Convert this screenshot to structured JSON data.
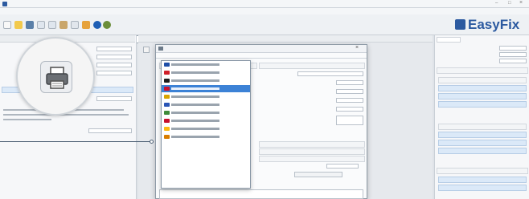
{
  "window": {
    "title": "",
    "minimize": "–",
    "maximize": "□",
    "close": "×"
  },
  "menu": [
    "",
    "",
    ""
  ],
  "toolbar": {
    "language_label": "",
    "brand": "EasyFix",
    "colors": {
      "brand_blue": "#2c5aa0",
      "selection": "#3c82d6",
      "header_blue": "#3a78c6"
    }
  },
  "left_panel": {
    "tabs": [
      "",
      "",
      ""
    ],
    "note": "",
    "value": ""
  },
  "center": {
    "tabs": [
      "",
      ""
    ]
  },
  "print_dialog": {
    "title": "",
    "tabs": [
      "",
      ""
    ],
    "close": "×",
    "language_section_header": "",
    "row_labels": [
      "",
      "",
      "",
      ""
    ],
    "languages": [
      {
        "code": "",
        "flag": "#1f4fa8",
        "selected": false
      },
      {
        "code": "",
        "flag": "#d0202a",
        "selected": false
      },
      {
        "code": "",
        "flag": "#1d1d1d",
        "selected": false
      },
      {
        "code": "",
        "flag": "#1f4fa8",
        "selected": true
      },
      {
        "code": "",
        "flag": "#d9a400",
        "selected": false
      },
      {
        "code": "",
        "flag": "#2a55b5",
        "selected": false
      },
      {
        "code": "",
        "flag": "#3e8b3a",
        "selected": false
      },
      {
        "code": "",
        "flag": "#c8102e",
        "selected": false
      },
      {
        "code": "",
        "flag": "#fdb913",
        "selected": false
      },
      {
        "code": "",
        "flag": "#d97d00",
        "selected": false
      }
    ],
    "project": {
      "header": "",
      "fields": [
        "",
        "",
        "",
        "",
        "",
        ""
      ]
    },
    "sections": [
      "",
      "",
      ""
    ],
    "print_date_label": "",
    "print_date_value": "",
    "save_default_label": "",
    "comment_label": ""
  },
  "result_panel": {
    "header": "",
    "rows": [
      "",
      "",
      ""
    ],
    "sections": [
      "",
      "",
      "",
      "",
      ""
    ],
    "values": [
      "",
      "",
      "",
      "",
      "",
      "",
      ""
    ]
  },
  "callout": {
    "icon": "printer-icon"
  }
}
